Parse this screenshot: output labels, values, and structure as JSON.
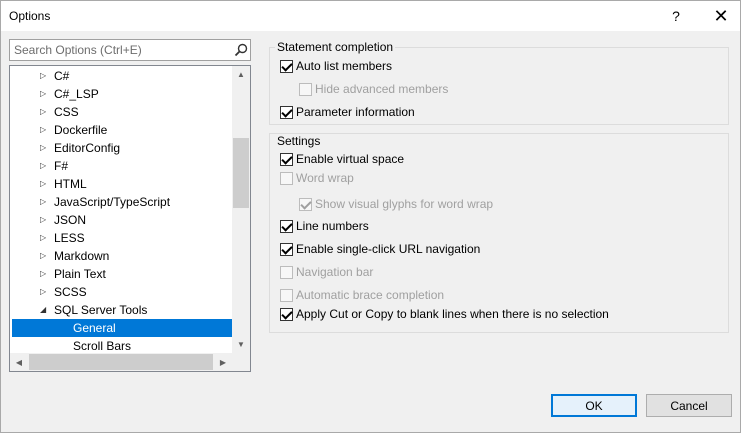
{
  "window": {
    "title": "Options",
    "help_glyph": "?",
    "close_glyph": "✕"
  },
  "search": {
    "placeholder": "Search Options (Ctrl+E)",
    "value": ""
  },
  "tree": {
    "items": [
      {
        "label": "C#",
        "expandable": true
      },
      {
        "label": "C#_LSP",
        "expandable": true
      },
      {
        "label": "CSS",
        "expandable": true
      },
      {
        "label": "Dockerfile",
        "expandable": true
      },
      {
        "label": "EditorConfig",
        "expandable": true
      },
      {
        "label": "F#",
        "expandable": true
      },
      {
        "label": "HTML",
        "expandable": true
      },
      {
        "label": "JavaScript/TypeScript",
        "expandable": true
      },
      {
        "label": "JSON",
        "expandable": true
      },
      {
        "label": "LESS",
        "expandable": true
      },
      {
        "label": "Markdown",
        "expandable": true
      },
      {
        "label": "Plain Text",
        "expandable": true
      },
      {
        "label": "SCSS",
        "expandable": true
      },
      {
        "label": "SQL Server Tools",
        "expandable": true,
        "expanded": true
      }
    ],
    "children": [
      {
        "label": "General",
        "selected": true
      },
      {
        "label": "Scroll Bars",
        "selected": false
      }
    ]
  },
  "statement_completion": {
    "title": "Statement completion",
    "options": [
      {
        "label": "Auto list members",
        "checked": true,
        "enabled": true
      },
      {
        "label": "Hide advanced members",
        "checked": false,
        "enabled": false
      },
      {
        "label": "Parameter information",
        "checked": true,
        "enabled": true
      }
    ]
  },
  "settings": {
    "title": "Settings",
    "options": [
      {
        "label": "Enable virtual space",
        "checked": true,
        "enabled": true
      },
      {
        "label": "Word wrap",
        "checked": false,
        "enabled": false
      },
      {
        "label": "Show visual glyphs for word wrap",
        "checked": true,
        "enabled": false
      },
      {
        "label": "Line numbers",
        "checked": true,
        "enabled": true
      },
      {
        "label": "Enable single-click URL navigation",
        "checked": true,
        "enabled": true
      },
      {
        "label": "Navigation bar",
        "checked": false,
        "enabled": false
      },
      {
        "label": "Automatic brace completion",
        "checked": false,
        "enabled": false
      },
      {
        "label": "Apply Cut or Copy to blank lines when there is no selection",
        "checked": true,
        "enabled": true
      }
    ]
  },
  "buttons": {
    "ok": "OK",
    "cancel": "Cancel"
  },
  "colors": {
    "selection": "#0078d7",
    "background": "#f0f0f0"
  }
}
